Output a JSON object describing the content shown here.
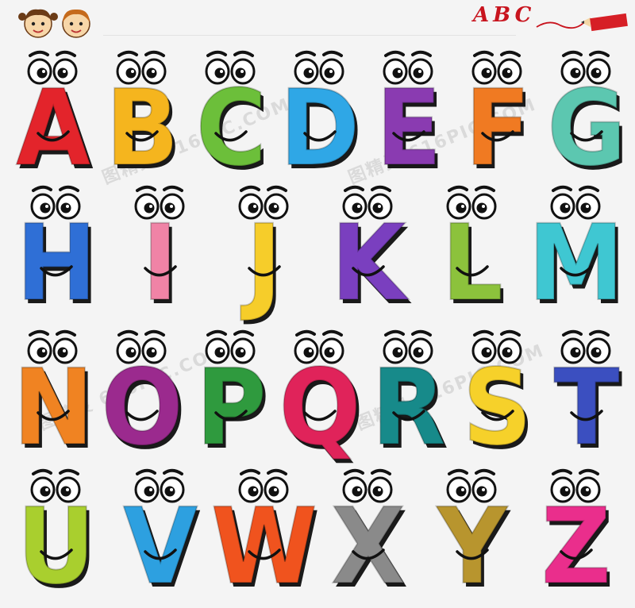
{
  "header": {
    "label": "ABC",
    "pencil_color": "#c8141e",
    "icons": [
      "kids-faces-icon",
      "red-pencil-icon"
    ]
  },
  "letters": [
    {
      "char": "A",
      "color": "#e3242b"
    },
    {
      "char": "B",
      "color": "#f5b51e"
    },
    {
      "char": "C",
      "color": "#6cbf3a"
    },
    {
      "char": "D",
      "color": "#2fa7e6"
    },
    {
      "char": "E",
      "color": "#8a3bb1"
    },
    {
      "char": "F",
      "color": "#f07a22"
    },
    {
      "char": "G",
      "color": "#5cc7b0"
    },
    {
      "char": "H",
      "color": "#2f6fd6"
    },
    {
      "char": "I",
      "color": "#f083a6"
    },
    {
      "char": "J",
      "color": "#f6cd2a"
    },
    {
      "char": "K",
      "color": "#7a3fbf"
    },
    {
      "char": "L",
      "color": "#8cc23c"
    },
    {
      "char": "M",
      "color": "#3fc7d2"
    },
    {
      "char": "N",
      "color": "#f08322"
    },
    {
      "char": "O",
      "color": "#9b2a8e"
    },
    {
      "char": "P",
      "color": "#2f9a3e"
    },
    {
      "char": "Q",
      "color": "#e0235a"
    },
    {
      "char": "R",
      "color": "#178a8a"
    },
    {
      "char": "S",
      "color": "#f6d12a"
    },
    {
      "char": "T",
      "color": "#3b4fc0"
    },
    {
      "char": "U",
      "color": "#a9cf2e"
    },
    {
      "char": "V",
      "color": "#2da0e0"
    },
    {
      "char": "W",
      "color": "#f0531e"
    },
    {
      "char": "X",
      "color": "#8a8a8a"
    },
    {
      "char": "Y",
      "color": "#b8952e"
    },
    {
      "char": "Z",
      "color": "#ea2e8c"
    }
  ]
}
